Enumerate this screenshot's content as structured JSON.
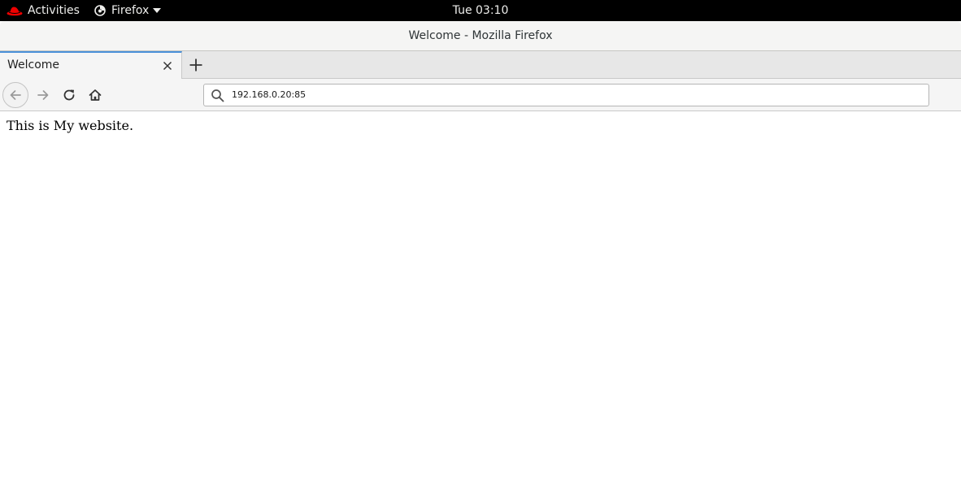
{
  "topbar": {
    "activities_label": "Activities",
    "app_menu_label": "Firefox",
    "clock": "Tue 03:10"
  },
  "window": {
    "title": "Welcome - Mozilla Firefox"
  },
  "tabs": [
    {
      "label": "Welcome",
      "active": true
    }
  ],
  "navbar": {
    "url": "192.168.0.20:85"
  },
  "page": {
    "text": "This is My website."
  },
  "icons": {
    "activities": "redhat-logo-icon",
    "app_menu": "firefox-icon",
    "app_menu_caret": "caret-down-icon",
    "tab_close": "close-icon",
    "new_tab": "plus-icon",
    "back": "back-arrow-icon",
    "forward": "forward-arrow-icon",
    "reload": "reload-icon",
    "home": "home-icon",
    "url_search": "search-icon"
  },
  "colors": {
    "topbar_bg": "#000000",
    "tab_accent": "#4a90d9",
    "logo_red": "#ee0000"
  }
}
